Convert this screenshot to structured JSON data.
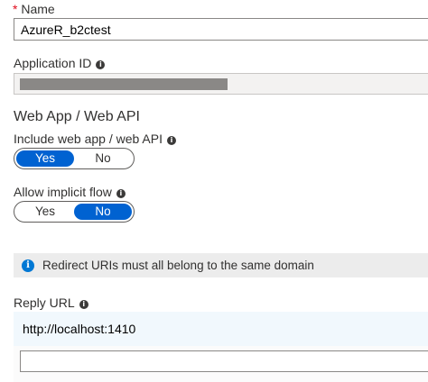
{
  "name_field": {
    "required_mark": "*",
    "label": "Name",
    "value": "AzureR_b2ctest"
  },
  "application_id": {
    "label": "Application ID",
    "value_redacted": true
  },
  "web_app_section": {
    "title": "Web App / Web API",
    "include_label": "Include web app / web API",
    "include_options": [
      "Yes",
      "No"
    ],
    "include_selected": "Yes",
    "implicit_label": "Allow implicit flow",
    "implicit_options": [
      "Yes",
      "No"
    ],
    "implicit_selected": "No"
  },
  "notice": {
    "text": "Redirect URIs must all belong to the same domain"
  },
  "reply_url": {
    "label": "Reply URL",
    "urls": [
      "http://localhost:1410"
    ],
    "new_url_value": ""
  },
  "colors": {
    "accent": "#0062d1",
    "info_blue": "#0078d4",
    "required_red": "#e00b1c",
    "notice_bg": "#ececec",
    "url_row_bg": "#f1f8fd"
  }
}
